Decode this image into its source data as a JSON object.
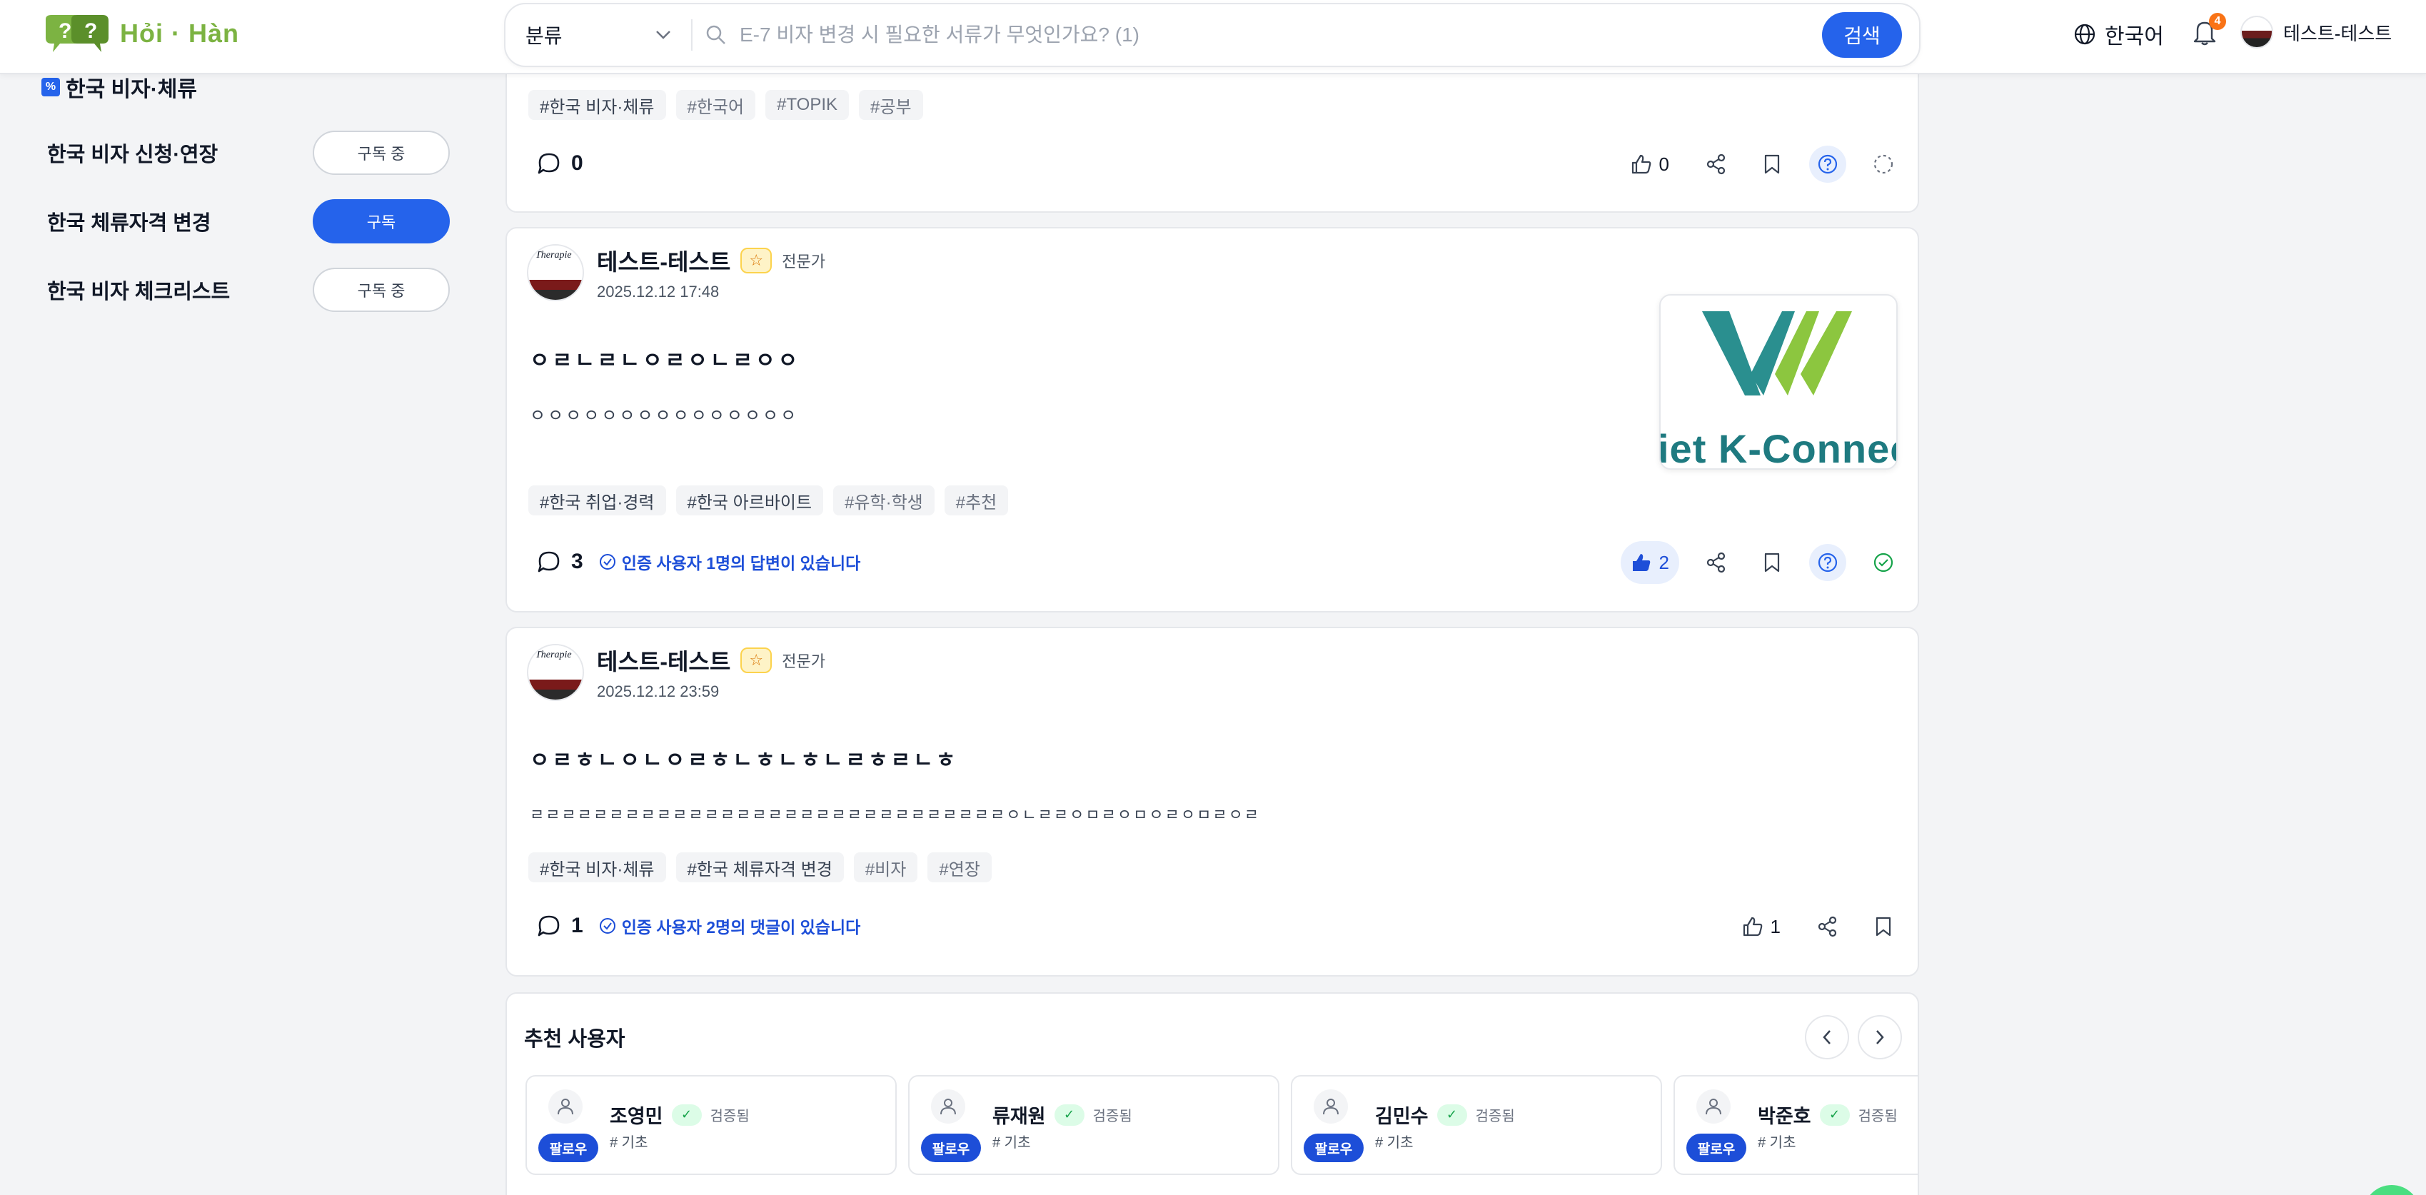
{
  "header": {
    "logo_text": "Hỏi · Hàn",
    "category_select": "분류",
    "search_placeholder": "E-7 비자 변경 시 필요한 서류가 무엇인가요? (1)",
    "search_button": "검색",
    "language": "한국어",
    "notification_count": "4",
    "username": "테스트-테스트"
  },
  "sidebar": {
    "category_label": "한국 비자·체류",
    "items": [
      {
        "label": "한국 비자 신청·연장",
        "button": "구독 중",
        "active": false
      },
      {
        "label": "한국 체류자격 변경",
        "button": "구독",
        "active": true
      },
      {
        "label": "한국 비자 체크리스트",
        "button": "구독 중",
        "active": false
      }
    ]
  },
  "posts": [
    {
      "tags": [
        "#한국 비자·체류",
        "#한국어",
        "#TOPIK",
        "#공부"
      ],
      "comments": "0",
      "likes": "0"
    },
    {
      "author": "테스트-테스트",
      "badge": "전문가",
      "date": "2025.12.12 17:48",
      "title": "ㅇㄹㄴㄹㄴㅇㄹㅇㄴㄹㅇㅇ",
      "body": "ㅇㅇㅇㅇㅇㅇㅇㅇㅇㅇㅇㅇㅇㅇㅇ",
      "thumbnail_text": "iet K-Connec",
      "tags": [
        "#한국 취업·경력",
        "#한국 아르바이트",
        "#유학·학생",
        "#추천"
      ],
      "comments": "3",
      "verified_note": "인증 사용자 1명의 답변이 있습니다",
      "likes": "2"
    },
    {
      "author": "테스트-테스트",
      "badge": "전문가",
      "date": "2025.12.12 23:59",
      "title": "ㅇㄹㅎㄴㅇㄴㅇㄹㅎㄴㅎㄴㅎㄴㄹㅎㄹㄴㅎ",
      "body": "ㄹㄹㄹㄹㄹㄹㄹㄹㄹㄹㄹㄹㄹㄹㄹㄹㄹㄹㄹㄹㄹㄹㄹㄹㄹㄹㄹㄹㄹㄹㅇㄴㄹㄹㅇㅁㄹㅇㅁㅇㄹㅇㅁㄹㅇㄹ",
      "tags": [
        "#한국 비자·체류",
        "#한국 체류자격 변경",
        "#비자",
        "#연장"
      ],
      "comments": "1",
      "verified_note": "인증 사용자 2명의 댓글이 있습니다",
      "likes": "1"
    }
  ],
  "recommended": {
    "title": "추천 사용자",
    "verified_label": "검증됨",
    "follow_label": "팔로우",
    "users": [
      {
        "name": "조영민",
        "level": "# 기초"
      },
      {
        "name": "류재원",
        "level": "# 기초"
      },
      {
        "name": "김민수",
        "level": "# 기초"
      },
      {
        "name": "박준호",
        "level": "# 기초"
      }
    ]
  },
  "colors": {
    "primary": "#2563eb",
    "logo_green": "#7cb342",
    "verified_green": "#16a34a",
    "badge_orange": "#f97316"
  }
}
